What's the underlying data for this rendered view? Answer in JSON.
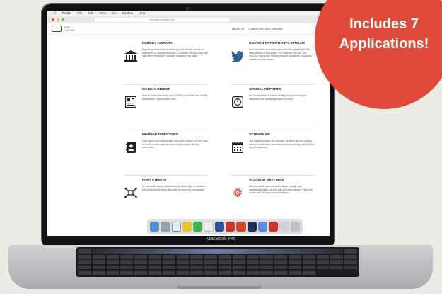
{
  "badge": {
    "line1": "Includes 7",
    "line2": "Applications!"
  },
  "menubar": {
    "items": [
      "Finder",
      "File",
      "Edit",
      "View",
      "Go",
      "Window",
      "Help"
    ]
  },
  "browser": {
    "url": "the-pulse.example.com"
  },
  "site": {
    "logo_line1": "THE",
    "logo_line2": "PULSE",
    "nav": [
      "ABOUT US",
      "CONSULTING AND TRAINING"
    ]
  },
  "cards": [
    {
      "title": "PEBODY LIBRARY",
      "icon": "library-icon",
      "desc": "A growing priceless trove where you can identify, access an assortment of Pebody resources. Go include Industry Days that have been presented in Industry throughout the years."
    },
    {
      "title": "GOVCON OPPORTUNITY STREAM",
      "icon": "twitter-icon",
      "desc": "Don't have time to monitor every GovCon opportunity? See every version of every line? The Pulse do it for you. Our GovCon Opportunity Stream provides 'snapshots' of contract updates as they happen."
    },
    {
      "title": "WEEKLY DIGEST",
      "icon": "newspaper-icon",
      "desc": "Want to review previously sent 'FITARA Quick Hits' and 'Weekly Newsletters'? Explore them here."
    },
    {
      "title": "SPECIAL REPORTS",
      "icon": "report-icon",
      "desc": "Our focused federal market intelligence reports help you understand the trends that make an impact."
    },
    {
      "title": "MEMBER DIRECTORY",
      "icon": "address-book-icon",
      "desc": "Learn about and network with your peers. Search for The Pulse of GovCon users and discover our growing and thriving community."
    },
    {
      "title": "SCHEDULER",
      "icon": "calendar-icon",
      "desc": "This feature provides our premium members with an ongoing advisory relationship and assistance in answering your GovCon specific questions."
    },
    {
      "title": "PART 9 (BETA)",
      "icon": "network-icon",
      "desc": "An interactive search platform using custom logic to translate the Government's terms into what you need for your pipeline."
    },
    {
      "title": "ACCOUNT SETTINGS",
      "icon": "gear-icon",
      "desc": "Need to update your account settings, change your membership status, or view your purchase history? Click here to view and edit your account settings."
    }
  ],
  "device_label": "MacBook Pro",
  "colors": {
    "badge": "#e04a3a",
    "accent_red": "#d9342b"
  }
}
